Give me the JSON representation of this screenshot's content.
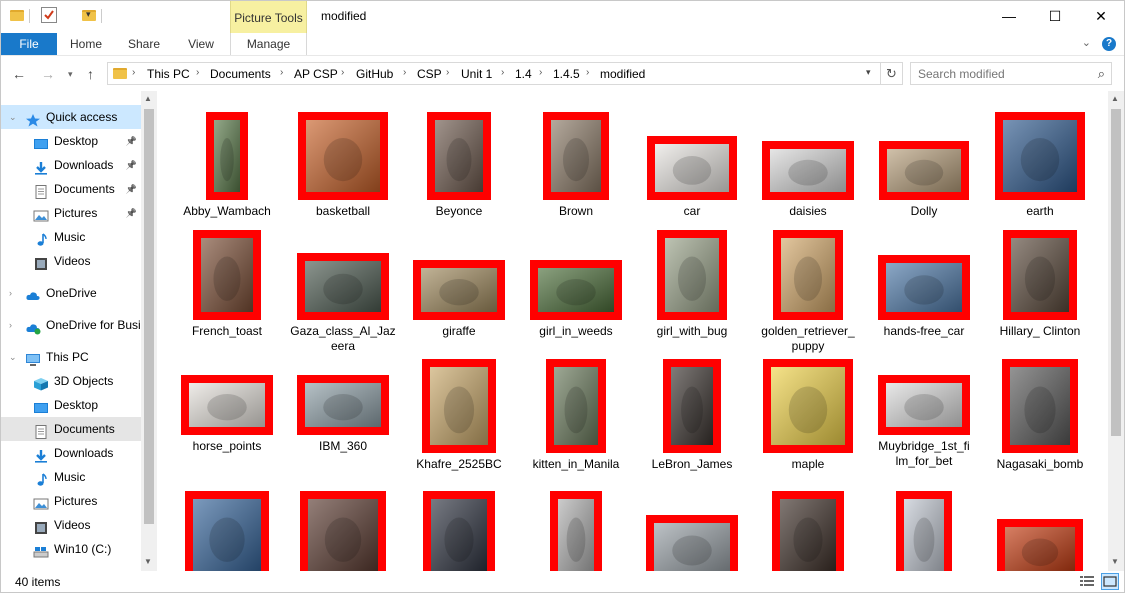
{
  "window": {
    "title": "modified",
    "picture_tools": "Picture Tools",
    "minimize": "—",
    "maximize": "☐",
    "close": "✕"
  },
  "ribbon": {
    "tabs": [
      "File",
      "Home",
      "Share",
      "View",
      "Manage"
    ]
  },
  "address": {
    "crumbs": [
      "This PC",
      "Documents",
      "AP CSP",
      "GitHub",
      "CSP",
      "Unit 1",
      "1.4",
      "1.4.5",
      "modified"
    ]
  },
  "search": {
    "placeholder": "Search modified"
  },
  "nav": {
    "items": [
      {
        "label": "Quick access",
        "icon": "star-icon"
      },
      {
        "label": "Desktop",
        "icon": "desktop-icon"
      },
      {
        "label": "Downloads",
        "icon": "download-icon"
      },
      {
        "label": "Documents",
        "icon": "document-icon"
      },
      {
        "label": "Pictures",
        "icon": "pictures-icon"
      },
      {
        "label": "Music",
        "icon": "music-icon"
      },
      {
        "label": "Videos",
        "icon": "video-icon"
      },
      {
        "label": "OneDrive",
        "icon": "cloud-icon"
      },
      {
        "label": "OneDrive for Busi",
        "icon": "cloud-business-icon"
      },
      {
        "label": "This PC",
        "icon": "computer-icon"
      },
      {
        "label": "3D Objects",
        "icon": "cube-icon"
      },
      {
        "label": "Desktop",
        "icon": "desktop-icon"
      },
      {
        "label": "Documents",
        "icon": "document-icon"
      },
      {
        "label": "Downloads",
        "icon": "download-icon"
      },
      {
        "label": "Music",
        "icon": "music-icon"
      },
      {
        "label": "Pictures",
        "icon": "pictures-icon"
      },
      {
        "label": "Videos",
        "icon": "video-icon"
      },
      {
        "label": "Win10 (C:)",
        "icon": "drive-icon"
      }
    ]
  },
  "files": [
    {
      "label": "Abby_Wambach",
      "color": "#5a7a4a"
    },
    {
      "label": "basketball",
      "color": "#c8622a"
    },
    {
      "label": "Beyonce",
      "color": "#6e5a4e"
    },
    {
      "label": "Brown",
      "color": "#8c7b68"
    },
    {
      "label": "car",
      "color": "#e9e6e2"
    },
    {
      "label": "daisies",
      "color": "#d8d8d8"
    },
    {
      "label": "Dolly",
      "color": "#b79f7c"
    },
    {
      "label": "earth",
      "color": "#2f5a8e"
    },
    {
      "label": "French_toast",
      "color": "#7b4e36"
    },
    {
      "label": "Gaza_class_Al_Jazeera",
      "color": "#4e5c52"
    },
    {
      "label": "giraffe",
      "color": "#a08a5e"
    },
    {
      "label": "girl_in_weeds",
      "color": "#4c6e3a"
    },
    {
      "label": "girl_with_bug",
      "color": "#9aa38a"
    },
    {
      "label": "golden_retriever_puppy",
      "color": "#d3a86a"
    },
    {
      "label": "hands-free_car",
      "color": "#4e79a8"
    },
    {
      "label": "Hillary_ Clinton",
      "color": "#5b4a3c"
    },
    {
      "label": "horse_points",
      "color": "#e6e2dc"
    },
    {
      "label": "IBM_360",
      "color": "#8fa0a8"
    },
    {
      "label": "Khafre_2525BC",
      "color": "#c9a86a"
    },
    {
      "label": "kitten_in_Manila",
      "color": "#6a7a5c"
    },
    {
      "label": "LeBron_James",
      "color": "#3b3430"
    },
    {
      "label": "maple",
      "color": "#f0d34a"
    },
    {
      "label": "Muybridge_1st_film_for_bet",
      "color": "#dcdcdc"
    },
    {
      "label": "Nagasaki_bomb",
      "color": "#5a5a5a"
    },
    {
      "label": "",
      "color": "#35649a"
    },
    {
      "label": "",
      "color": "#5a3a30"
    },
    {
      "label": "",
      "color": "#2e3340"
    },
    {
      "label": "",
      "color": "#b0b0b0"
    },
    {
      "label": "",
      "color": "#9aa2a8"
    },
    {
      "label": "",
      "color": "#3d2f28"
    },
    {
      "label": "",
      "color": "#c2c8d2"
    },
    {
      "label": "",
      "color": "#c23a10"
    }
  ],
  "status": {
    "count": "40 items"
  },
  "colors": {
    "accent": "#1979ca",
    "thumb_border": "#ff0000",
    "selection": "#cce8ff"
  }
}
